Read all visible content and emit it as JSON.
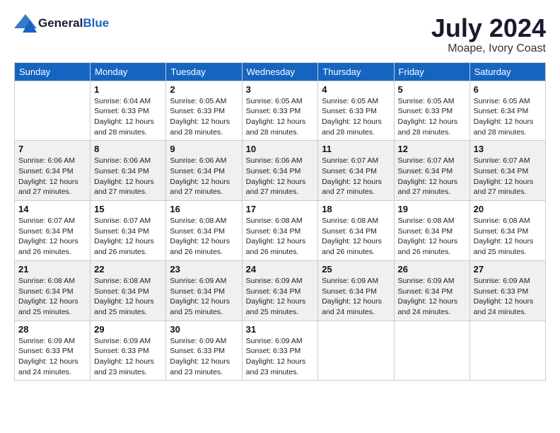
{
  "header": {
    "logo_general": "General",
    "logo_blue": "Blue",
    "month_year": "July 2024",
    "location": "Moape, Ivory Coast"
  },
  "days_of_week": [
    "Sunday",
    "Monday",
    "Tuesday",
    "Wednesday",
    "Thursday",
    "Friday",
    "Saturday"
  ],
  "weeks": [
    {
      "row_class": "row-white",
      "days": [
        {
          "num": "",
          "info": ""
        },
        {
          "num": "1",
          "info": "Sunrise: 6:04 AM\nSunset: 6:33 PM\nDaylight: 12 hours\nand 28 minutes."
        },
        {
          "num": "2",
          "info": "Sunrise: 6:05 AM\nSunset: 6:33 PM\nDaylight: 12 hours\nand 28 minutes."
        },
        {
          "num": "3",
          "info": "Sunrise: 6:05 AM\nSunset: 6:33 PM\nDaylight: 12 hours\nand 28 minutes."
        },
        {
          "num": "4",
          "info": "Sunrise: 6:05 AM\nSunset: 6:33 PM\nDaylight: 12 hours\nand 28 minutes."
        },
        {
          "num": "5",
          "info": "Sunrise: 6:05 AM\nSunset: 6:33 PM\nDaylight: 12 hours\nand 28 minutes."
        },
        {
          "num": "6",
          "info": "Sunrise: 6:05 AM\nSunset: 6:34 PM\nDaylight: 12 hours\nand 28 minutes."
        }
      ]
    },
    {
      "row_class": "row-gray",
      "days": [
        {
          "num": "7",
          "info": "Sunrise: 6:06 AM\nSunset: 6:34 PM\nDaylight: 12 hours\nand 27 minutes."
        },
        {
          "num": "8",
          "info": "Sunrise: 6:06 AM\nSunset: 6:34 PM\nDaylight: 12 hours\nand 27 minutes."
        },
        {
          "num": "9",
          "info": "Sunrise: 6:06 AM\nSunset: 6:34 PM\nDaylight: 12 hours\nand 27 minutes."
        },
        {
          "num": "10",
          "info": "Sunrise: 6:06 AM\nSunset: 6:34 PM\nDaylight: 12 hours\nand 27 minutes."
        },
        {
          "num": "11",
          "info": "Sunrise: 6:07 AM\nSunset: 6:34 PM\nDaylight: 12 hours\nand 27 minutes."
        },
        {
          "num": "12",
          "info": "Sunrise: 6:07 AM\nSunset: 6:34 PM\nDaylight: 12 hours\nand 27 minutes."
        },
        {
          "num": "13",
          "info": "Sunrise: 6:07 AM\nSunset: 6:34 PM\nDaylight: 12 hours\nand 27 minutes."
        }
      ]
    },
    {
      "row_class": "row-white",
      "days": [
        {
          "num": "14",
          "info": "Sunrise: 6:07 AM\nSunset: 6:34 PM\nDaylight: 12 hours\nand 26 minutes."
        },
        {
          "num": "15",
          "info": "Sunrise: 6:07 AM\nSunset: 6:34 PM\nDaylight: 12 hours\nand 26 minutes."
        },
        {
          "num": "16",
          "info": "Sunrise: 6:08 AM\nSunset: 6:34 PM\nDaylight: 12 hours\nand 26 minutes."
        },
        {
          "num": "17",
          "info": "Sunrise: 6:08 AM\nSunset: 6:34 PM\nDaylight: 12 hours\nand 26 minutes."
        },
        {
          "num": "18",
          "info": "Sunrise: 6:08 AM\nSunset: 6:34 PM\nDaylight: 12 hours\nand 26 minutes."
        },
        {
          "num": "19",
          "info": "Sunrise: 6:08 AM\nSunset: 6:34 PM\nDaylight: 12 hours\nand 26 minutes."
        },
        {
          "num": "20",
          "info": "Sunrise: 6:08 AM\nSunset: 6:34 PM\nDaylight: 12 hours\nand 25 minutes."
        }
      ]
    },
    {
      "row_class": "row-gray",
      "days": [
        {
          "num": "21",
          "info": "Sunrise: 6:08 AM\nSunset: 6:34 PM\nDaylight: 12 hours\nand 25 minutes."
        },
        {
          "num": "22",
          "info": "Sunrise: 6:08 AM\nSunset: 6:34 PM\nDaylight: 12 hours\nand 25 minutes."
        },
        {
          "num": "23",
          "info": "Sunrise: 6:09 AM\nSunset: 6:34 PM\nDaylight: 12 hours\nand 25 minutes."
        },
        {
          "num": "24",
          "info": "Sunrise: 6:09 AM\nSunset: 6:34 PM\nDaylight: 12 hours\nand 25 minutes."
        },
        {
          "num": "25",
          "info": "Sunrise: 6:09 AM\nSunset: 6:34 PM\nDaylight: 12 hours\nand 24 minutes."
        },
        {
          "num": "26",
          "info": "Sunrise: 6:09 AM\nSunset: 6:34 PM\nDaylight: 12 hours\nand 24 minutes."
        },
        {
          "num": "27",
          "info": "Sunrise: 6:09 AM\nSunset: 6:33 PM\nDaylight: 12 hours\nand 24 minutes."
        }
      ]
    },
    {
      "row_class": "row-white",
      "days": [
        {
          "num": "28",
          "info": "Sunrise: 6:09 AM\nSunset: 6:33 PM\nDaylight: 12 hours\nand 24 minutes."
        },
        {
          "num": "29",
          "info": "Sunrise: 6:09 AM\nSunset: 6:33 PM\nDaylight: 12 hours\nand 23 minutes."
        },
        {
          "num": "30",
          "info": "Sunrise: 6:09 AM\nSunset: 6:33 PM\nDaylight: 12 hours\nand 23 minutes."
        },
        {
          "num": "31",
          "info": "Sunrise: 6:09 AM\nSunset: 6:33 PM\nDaylight: 12 hours\nand 23 minutes."
        },
        {
          "num": "",
          "info": ""
        },
        {
          "num": "",
          "info": ""
        },
        {
          "num": "",
          "info": ""
        }
      ]
    }
  ]
}
